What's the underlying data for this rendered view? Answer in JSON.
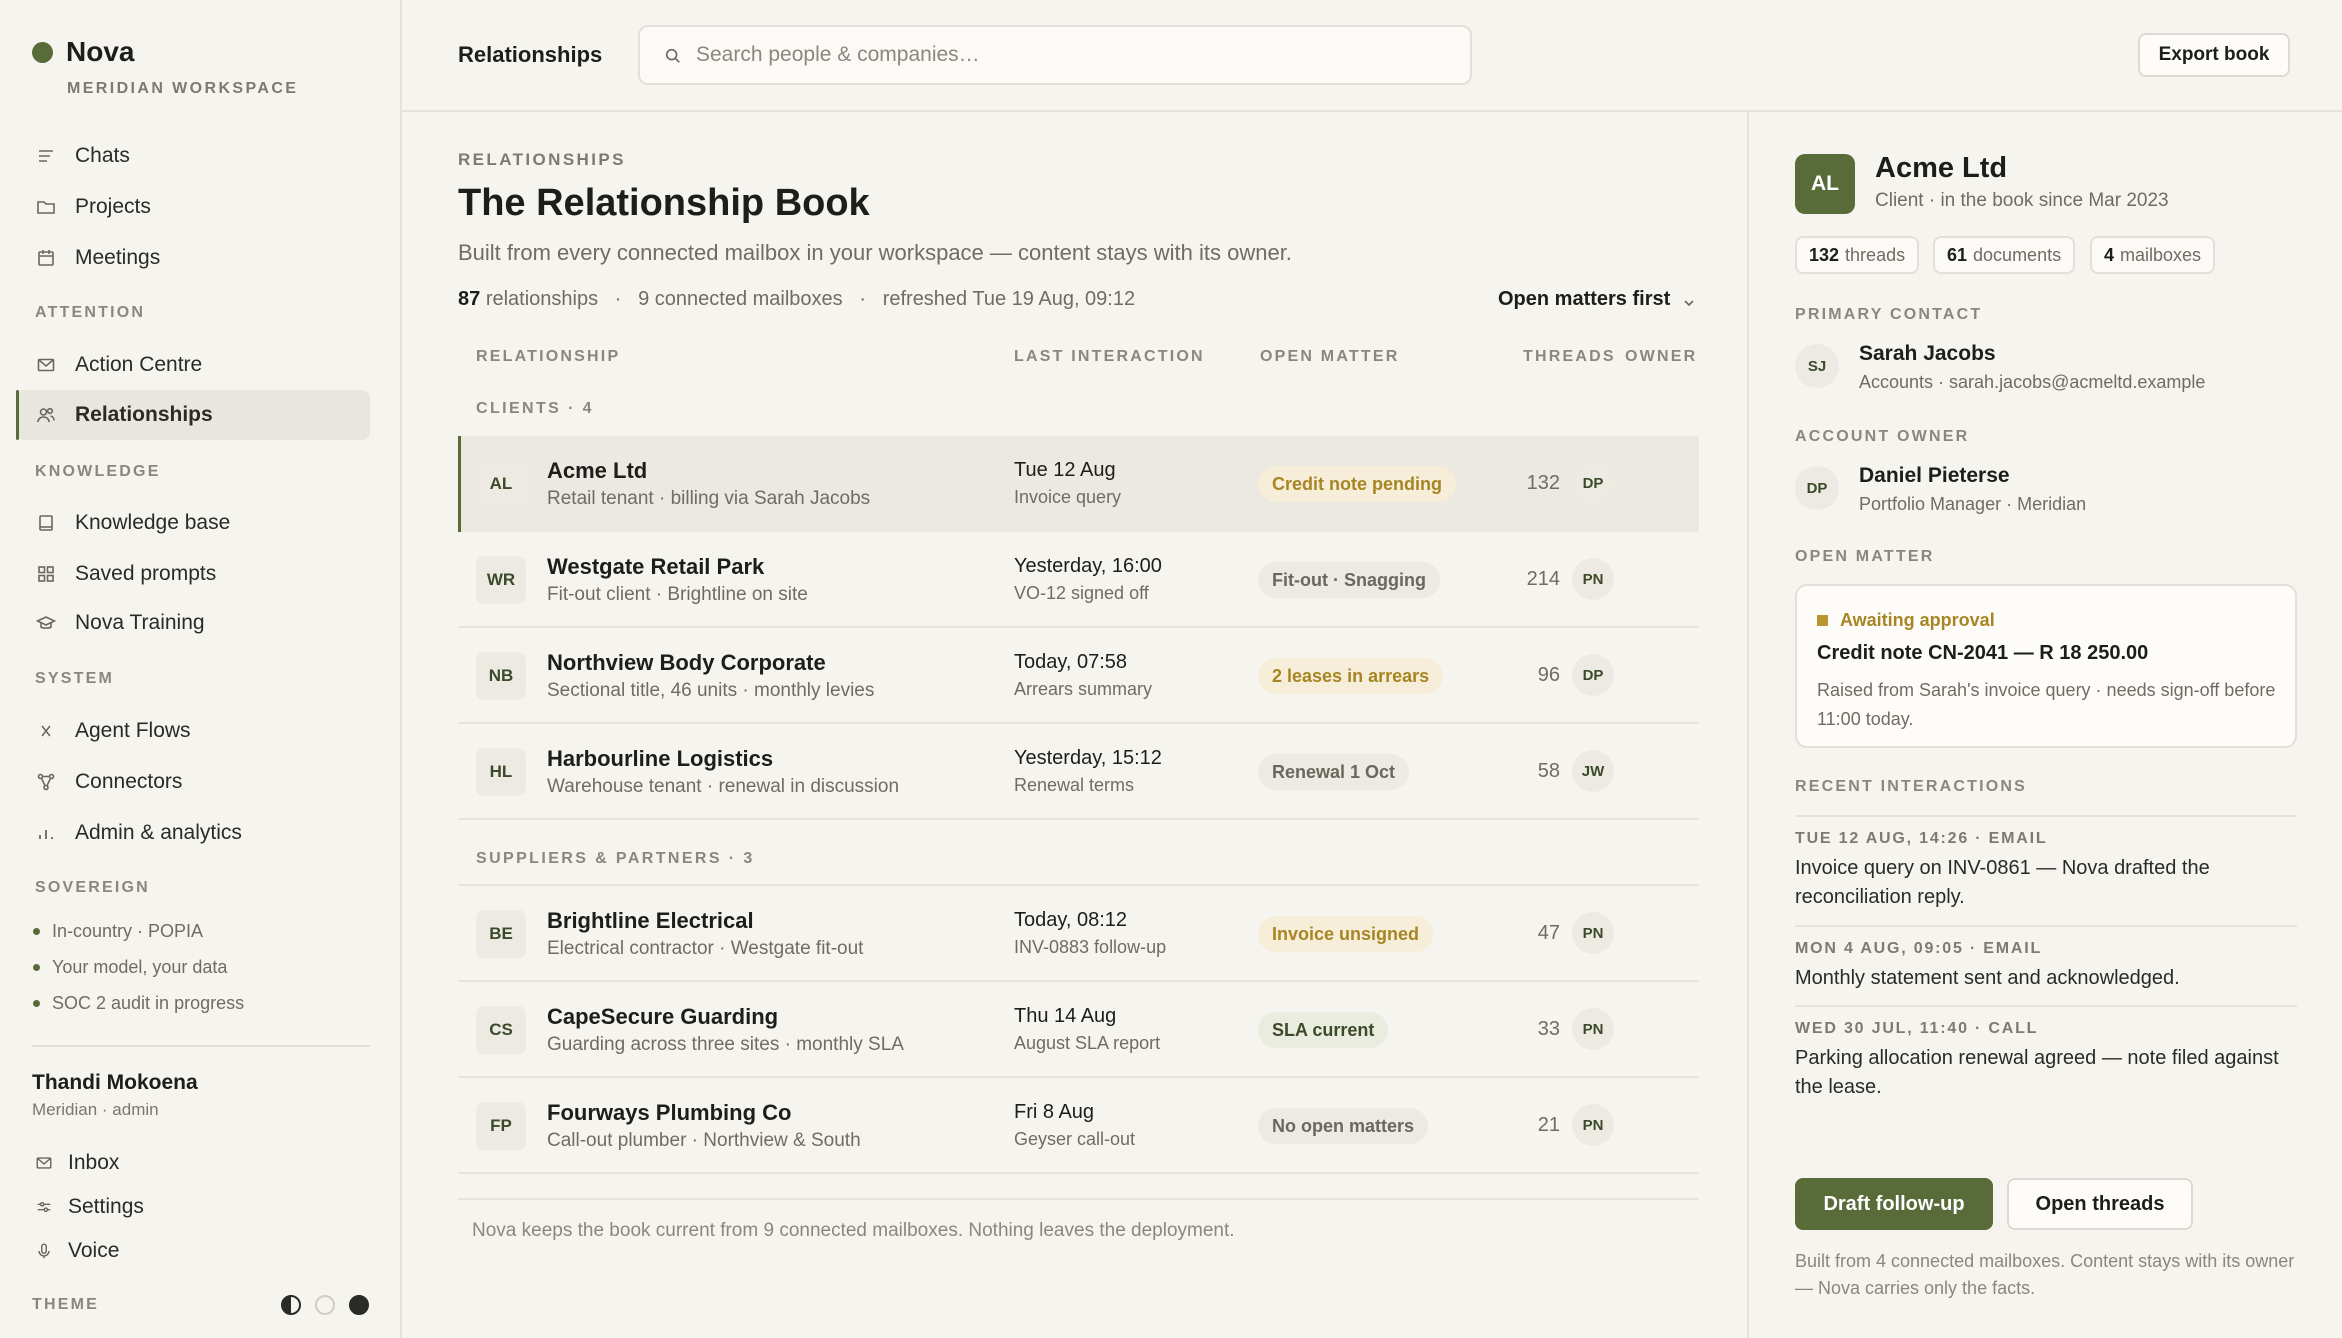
{
  "app": {
    "name": "Nova",
    "workspace": "MERIDIAN WORKSPACE"
  },
  "colors": {
    "accent": "#5a6b3a",
    "warning": "#a88524",
    "background": "#f5f4ef"
  },
  "sidebar": {
    "primary": [
      {
        "label": "Chats",
        "icon": "chat-lines-icon"
      },
      {
        "label": "Projects",
        "icon": "folder-icon"
      },
      {
        "label": "Meetings",
        "icon": "calendar-icon"
      }
    ],
    "attention": {
      "title": "ATTENTION",
      "items": [
        {
          "label": "Action Centre",
          "icon": "mail-icon"
        },
        {
          "label": "Relationships",
          "icon": "people-icon",
          "active": true
        }
      ]
    },
    "knowledge": {
      "title": "KNOWLEDGE",
      "items": [
        {
          "label": "Knowledge base",
          "icon": "book-icon"
        },
        {
          "label": "Saved prompts",
          "icon": "grid-icon"
        },
        {
          "label": "Nova Training",
          "icon": "graduation-cap-icon"
        }
      ]
    },
    "system": {
      "title": "SYSTEM",
      "items": [
        {
          "label": "Agent Flows",
          "icon": "function-icon"
        },
        {
          "label": "Connectors",
          "icon": "network-icon"
        },
        {
          "label": "Admin & analytics",
          "icon": "bar-chart-icon"
        }
      ]
    },
    "sovereign": {
      "title": "SOVEREIGN",
      "items": [
        "In-country · POPIA",
        "Your model, your data",
        "SOC 2 audit in progress"
      ]
    },
    "user": {
      "name": "Thandi Mokoena",
      "role": "Meridian · admin"
    },
    "bottom": [
      {
        "label": "Inbox",
        "icon": "mail-icon"
      },
      {
        "label": "Settings",
        "icon": "sliders-icon"
      },
      {
        "label": "Voice",
        "icon": "microphone-icon"
      }
    ],
    "theme_label": "THEME"
  },
  "topbar": {
    "title": "Relationships",
    "search_placeholder": "Search people & companies…",
    "export_label": "Export book"
  },
  "main": {
    "eyebrow": "RELATIONSHIPS",
    "title": "The Relationship Book",
    "description": "Built from every connected mailbox in your workspace — content stays with its owner.",
    "meta": {
      "count": "87",
      "count_label": "relationships",
      "mailboxes": "9 connected mailboxes",
      "refreshed": "refreshed Tue 19 Aug, 09:12"
    },
    "sort_label": "Open matters first",
    "columns": {
      "relationship": "RELATIONSHIP",
      "last_interaction": "LAST INTERACTION",
      "open_matter": "OPEN MATTER",
      "threads": "THREADS",
      "owner": "OWNER"
    },
    "groups": [
      {
        "title": "CLIENTS · 4",
        "rows": [
          {
            "initials": "AL",
            "name": "Acme Ltd",
            "sub": "Retail tenant · billing via Sarah Jacobs",
            "when": "Tue 12 Aug",
            "what": "Invoice query",
            "matter": "Credit note pending",
            "matter_tone": "warn",
            "threads": "132",
            "owner": "DP",
            "selected": true
          },
          {
            "initials": "WR",
            "name": "Westgate Retail Park",
            "sub": "Fit-out client · Brightline on site",
            "when": "Yesterday, 16:00",
            "what": "VO-12 signed off",
            "matter": "Fit-out · Snagging",
            "matter_tone": "neutral",
            "threads": "214",
            "owner": "PN"
          },
          {
            "initials": "NB",
            "name": "Northview Body Corporate",
            "sub": "Sectional title, 46 units · monthly levies",
            "when": "Today, 07:58",
            "what": "Arrears summary",
            "matter": "2 leases in arrears",
            "matter_tone": "warn",
            "threads": "96",
            "owner": "DP"
          },
          {
            "initials": "HL",
            "name": "Harbourline Logistics",
            "sub": "Warehouse tenant · renewal in discussion",
            "when": "Yesterday, 15:12",
            "what": "Renewal terms",
            "matter": "Renewal 1 Oct",
            "matter_tone": "neutral",
            "threads": "58",
            "owner": "JW"
          }
        ]
      },
      {
        "title": "SUPPLIERS & PARTNERS · 3",
        "rows": [
          {
            "initials": "BE",
            "name": "Brightline Electrical",
            "sub": "Electrical contractor · Westgate fit-out",
            "when": "Today, 08:12",
            "what": "INV-0883 follow-up",
            "matter": "Invoice unsigned",
            "matter_tone": "warn",
            "threads": "47",
            "owner": "PN"
          },
          {
            "initials": "CS",
            "name": "CapeSecure Guarding",
            "sub": "Guarding across three sites · monthly SLA",
            "when": "Thu 14 Aug",
            "what": "August SLA report",
            "matter": "SLA current",
            "matter_tone": "good",
            "threads": "33",
            "owner": "PN"
          },
          {
            "initials": "FP",
            "name": "Fourways Plumbing Co",
            "sub": "Call-out plumber · Northview & South",
            "when": "Fri 8 Aug",
            "what": "Geyser call-out",
            "matter": "No open matters",
            "matter_tone": "neutral",
            "threads": "21",
            "owner": "PN"
          }
        ]
      }
    ],
    "footnote": "Nova keeps the book current from 9 connected mailboxes. Nothing leaves the deployment."
  },
  "detail": {
    "initials": "AL",
    "name": "Acme Ltd",
    "subtitle": "Client · in the book since Mar 2023",
    "stats": [
      {
        "value": "132",
        "label": "threads"
      },
      {
        "value": "61",
        "label": "documents"
      },
      {
        "value": "4",
        "label": "mailboxes"
      }
    ],
    "primary_contact": {
      "title": "PRIMARY CONTACT",
      "initials": "SJ",
      "name": "Sarah Jacobs",
      "sub": "Accounts · sarah.jacobs@acmeltd.example"
    },
    "account_owner": {
      "title": "ACCOUNT OWNER",
      "initials": "DP",
      "name": "Daniel Pieterse",
      "sub": "Portfolio Manager · Meridian"
    },
    "open_matter": {
      "title": "OPEN MATTER",
      "status": "Awaiting approval",
      "headline": "Credit note CN-2041 — R 18 250.00",
      "description": "Raised from Sarah's invoice query · needs sign-off before 11:00 today."
    },
    "recent": {
      "title": "RECENT INTERACTIONS",
      "items": [
        {
          "meta": "TUE 12 AUG, 14:26 · EMAIL",
          "text": "Invoice query on INV-0861 — Nova drafted the reconciliation reply."
        },
        {
          "meta": "MON 4 AUG, 09:05 · EMAIL",
          "text": "Monthly statement sent and acknowledged."
        },
        {
          "meta": "WED 30 JUL, 11:40 · CALL",
          "text": "Parking allocation renewal agreed — note filed against the lease."
        }
      ]
    },
    "primary_action": "Draft follow-up",
    "secondary_action": "Open threads",
    "note": "Built from 4 connected mailboxes. Content stays with its owner — Nova carries only the facts."
  }
}
